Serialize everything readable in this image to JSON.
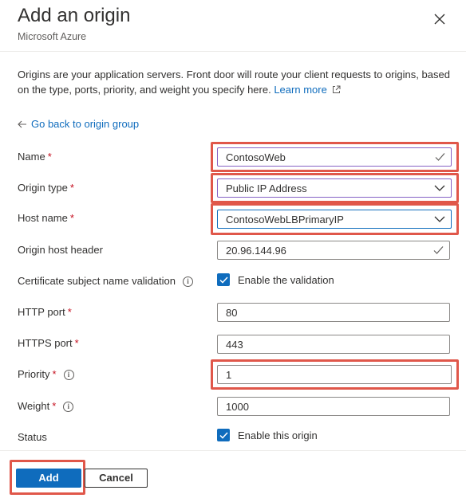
{
  "header": {
    "title": "Add an origin",
    "subtitle": "Microsoft Azure",
    "close_icon": "close-icon"
  },
  "description": {
    "text": "Origins are your application servers. Front door will route your client requests to origins, based on the type, ports, priority, and weight you specify here. ",
    "link": "Learn more"
  },
  "back_link": "Go back to origin group",
  "form": {
    "name": {
      "label": "Name",
      "value": "ContosoWeb"
    },
    "origin_type": {
      "label": "Origin type",
      "value": "Public IP Address"
    },
    "host_name": {
      "label": "Host name",
      "value": "ContosoWebLBPrimaryIP"
    },
    "origin_host_header": {
      "label": "Origin host header",
      "value": "20.96.144.96"
    },
    "cert_validation": {
      "label": "Certificate subject name validation",
      "checkbox_label": "Enable the validation",
      "checked": true
    },
    "http_port": {
      "label": "HTTP port",
      "value": "80"
    },
    "https_port": {
      "label": "HTTPS port",
      "value": "443"
    },
    "priority": {
      "label": "Priority",
      "value": "1"
    },
    "weight": {
      "label": "Weight",
      "value": "1000"
    },
    "status": {
      "label": "Status",
      "checkbox_label": "Enable this origin",
      "checked": true
    }
  },
  "footer": {
    "add_label": "Add",
    "cancel_label": "Cancel"
  },
  "colors": {
    "accent": "#0f6cbd",
    "highlight": "#e0574a",
    "required": "#c50f1f"
  }
}
